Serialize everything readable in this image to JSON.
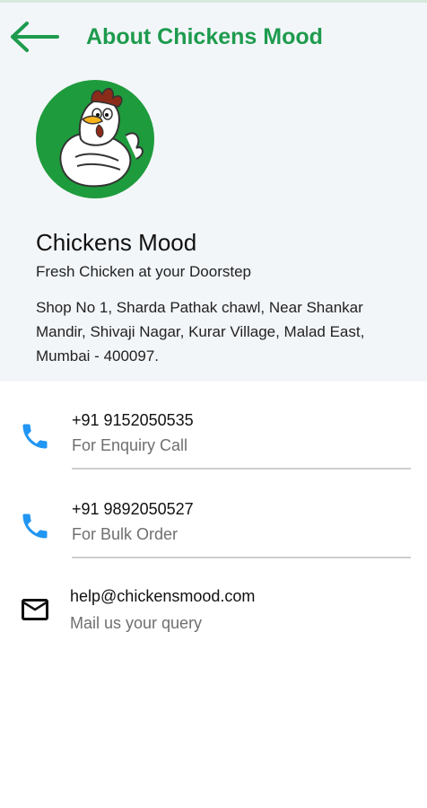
{
  "header": {
    "title": "About Chickens Mood",
    "back_icon": "arrow-left-icon",
    "accent_color": "#1e9b4e"
  },
  "profile": {
    "name": "Chickens Mood",
    "tagline": "Fresh Chicken at your Doorstep",
    "address": "Shop No 1, Sharda Pathak chawl, Near Shankar Mandir, Shivaji Nagar, Kurar Village, Malad East, Mumbai - 400097.",
    "logo_icon": "chicken-mascot-logo",
    "logo_bg_color": "#1e9b3c"
  },
  "contacts": [
    {
      "icon": "phone-icon",
      "primary": "+91 9152050535",
      "secondary": "For Enquiry Call"
    },
    {
      "icon": "phone-icon",
      "primary": "+91 9892050527",
      "secondary": "For Bulk Order"
    },
    {
      "icon": "mail-icon",
      "primary": "help@chickensmood.com",
      "secondary": "Mail us your query"
    }
  ],
  "colors": {
    "phone_icon": "#2196f3",
    "header_bg": "#f3f6f9"
  }
}
